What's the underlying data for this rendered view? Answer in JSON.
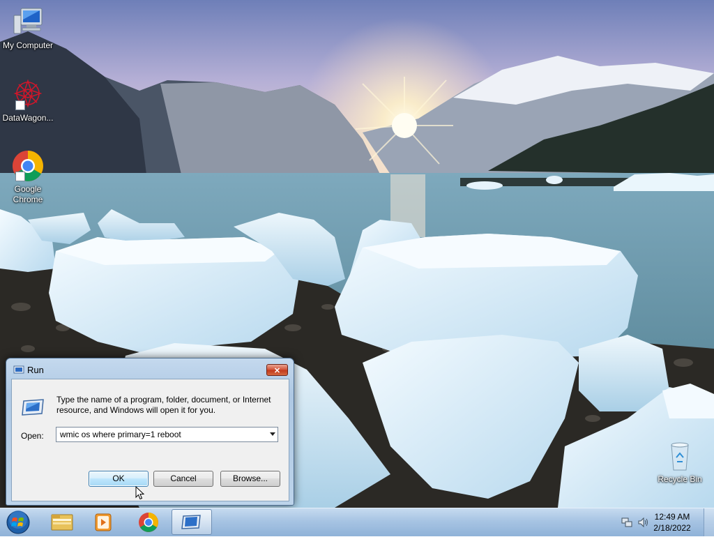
{
  "desktop": {
    "icons": [
      {
        "label": "My Computer"
      },
      {
        "label": "DataWagon..."
      },
      {
        "label": "Google Chrome"
      },
      {
        "label": "Recycle Bin"
      }
    ]
  },
  "run_dialog": {
    "title": "Run",
    "close_glyph": "✕",
    "description": "Type the name of a program, folder, document, or Internet resource, and Windows will open it for you.",
    "open_label": "Open:",
    "open_value": "wmic os where primary=1 reboot",
    "ok_label": "OK",
    "cancel_label": "Cancel",
    "browse_label": "Browse..."
  },
  "taskbar": {
    "start_icon": "windows-orb-icon",
    "pinned": [
      "explorer-folder-icon",
      "media-player-icon",
      "chrome-icon",
      "run-app-icon"
    ],
    "active_item": "run-app-icon"
  },
  "tray": {
    "icons": [
      "network-icon",
      "volume-icon"
    ],
    "time": "12:49 AM",
    "date": "2/18/2022"
  },
  "colors": {
    "taskbar": "#a7c4e3",
    "close_button": "#c23a1c",
    "ok_button_border": "#3c7fb1"
  }
}
